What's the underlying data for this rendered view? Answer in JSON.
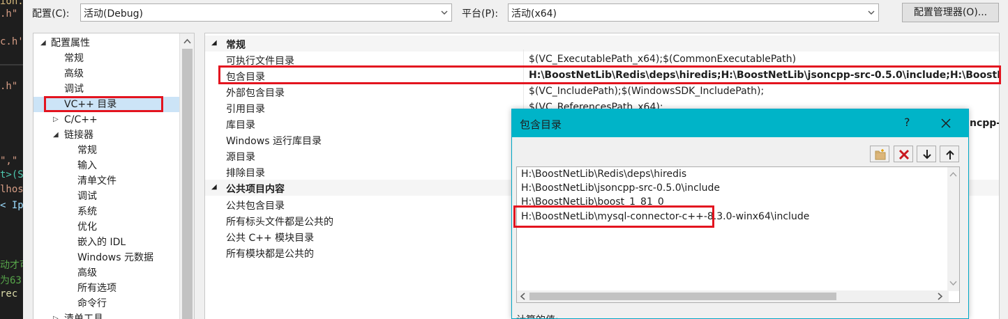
{
  "editor": {
    "lines": [
      {
        "text": "ion.",
        "color": "#d7ba7d"
      },
      {
        "text": ".h\"",
        "color": "#d69d85"
      },
      {
        "text": "c.h'",
        "color": "#d69d85"
      },
      {
        "text": ".h\"",
        "color": "#d69d85"
      },
      {
        "text": "\",\"",
        "color": "#d69d85"
      },
      {
        "text": "t>(S",
        "color": "#4ec9b0"
      },
      {
        "text": "lhos",
        "color": "#d69d85"
      },
      {
        "text": "< Ip",
        "color": "#9cdcfe"
      },
      {
        "text": "动才可",
        "color": "#57a64a"
      },
      {
        "text": "为63",
        "color": "#57a64a"
      },
      {
        "text": "rec",
        "color": "#dcdcaa"
      }
    ]
  },
  "topbar": {
    "config_label": "配置(C):",
    "config_value": "活动(Debug)",
    "platform_label": "平台(P):",
    "platform_value": "活动(x64)",
    "config_manager_button": "配置管理器(O)..."
  },
  "tree": {
    "items": [
      {
        "label": "配置属性",
        "toggle": "◢"
      },
      {
        "label": "常规",
        "toggle": ""
      },
      {
        "label": "高级",
        "toggle": ""
      },
      {
        "label": "调试",
        "toggle": ""
      },
      {
        "label": "VC++ 目录",
        "toggle": ""
      },
      {
        "label": "C/C++",
        "toggle": "▷"
      },
      {
        "label": "链接器",
        "toggle": "◢"
      },
      {
        "label": "常规",
        "toggle": ""
      },
      {
        "label": "输入",
        "toggle": ""
      },
      {
        "label": "清单文件",
        "toggle": ""
      },
      {
        "label": "调试",
        "toggle": ""
      },
      {
        "label": "系统",
        "toggle": ""
      },
      {
        "label": "优化",
        "toggle": ""
      },
      {
        "label": "嵌入的 IDL",
        "toggle": ""
      },
      {
        "label": "Windows 元数据",
        "toggle": ""
      },
      {
        "label": "高级",
        "toggle": ""
      },
      {
        "label": "所有选项",
        "toggle": ""
      },
      {
        "label": "命令行",
        "toggle": ""
      },
      {
        "label": "清单工具",
        "toggle": "▷"
      }
    ]
  },
  "grid": {
    "category_general": "常规",
    "category_public": "公共项目内容",
    "rows": [
      {
        "name": "可执行文件目录",
        "value": "$(VC_ExecutablePath_x64);$(CommonExecutablePath)"
      },
      {
        "name": "包含目录",
        "value": "H:\\BoostNetLib\\Redis\\deps\\hiredis;H:\\BoostNetLib\\jsoncpp-src-0.5.0\\include;H:\\BoostNe"
      },
      {
        "name": "外部包含目录",
        "value": "$(VC_IncludePath);$(WindowsSDK_IncludePath);"
      },
      {
        "name": "引用目录",
        "value": "$(VC_ReferencesPath_x64);"
      },
      {
        "name": "库目录",
        "value": "ncpp-s"
      },
      {
        "name": "Windows 运行库目录",
        "value": ""
      },
      {
        "name": "源目录",
        "value": ""
      },
      {
        "name": "排除目录",
        "value": ""
      }
    ],
    "public_rows": [
      {
        "name": "公共包含目录"
      },
      {
        "name": "所有标头文件都是公共的"
      },
      {
        "name": "公共 C++ 模块目录"
      },
      {
        "name": "所有模块都是公共的"
      }
    ]
  },
  "popup": {
    "title": "包含目录",
    "help": "?",
    "entries": [
      "H:\\BoostNetLib\\Redis\\deps\\hiredis",
      "H:\\BoostNetLib\\jsoncpp-src-0.5.0\\include",
      "H:\\BoostNetLib\\boost_1_81_0",
      "H:\\BoostNetLib\\mysql-connector-c++-8.3.0-winx64\\include"
    ],
    "bottom_label": "计算的值:"
  },
  "colors": {
    "highlight_red": "#e3141f",
    "popup_title_bg": "#00b4c8",
    "selected_tree_bg": "#cce4f7"
  }
}
